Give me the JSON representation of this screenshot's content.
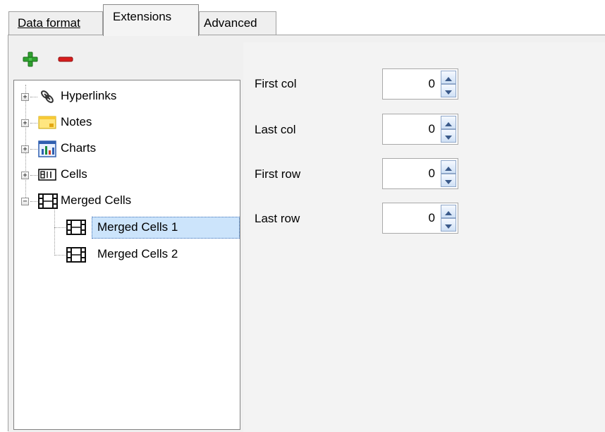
{
  "tabs": {
    "data_format": "Data format",
    "extensions": "Extensions",
    "advanced": "Advanced"
  },
  "toolbar": {
    "add_icon": "plus-icon",
    "remove_icon": "minus-icon",
    "add_color": "#2fa12f",
    "remove_color": "#d81d1d"
  },
  "tree": {
    "items": [
      {
        "label": "Hyperlinks",
        "icon": "hyperlink-icon",
        "expander": "+"
      },
      {
        "label": "Notes",
        "icon": "note-icon",
        "expander": "+"
      },
      {
        "label": "Charts",
        "icon": "chart-icon",
        "expander": "+"
      },
      {
        "label": "Cells",
        "icon": "cell-icon",
        "expander": "+"
      },
      {
        "label": "Merged Cells",
        "icon": "merged-cells-icon",
        "expander": "−"
      },
      {
        "label": "Merged Cells 1",
        "icon": "merged-cells-icon",
        "selected": true
      },
      {
        "label": "Merged Cells 2",
        "icon": "merged-cells-icon"
      }
    ]
  },
  "fields": {
    "first_col": {
      "label": "First col",
      "value": "0"
    },
    "last_col": {
      "label": "Last col",
      "value": "0"
    },
    "first_row": {
      "label": "First row",
      "value": "0"
    },
    "last_row": {
      "label": "Last row",
      "value": "0"
    }
  }
}
